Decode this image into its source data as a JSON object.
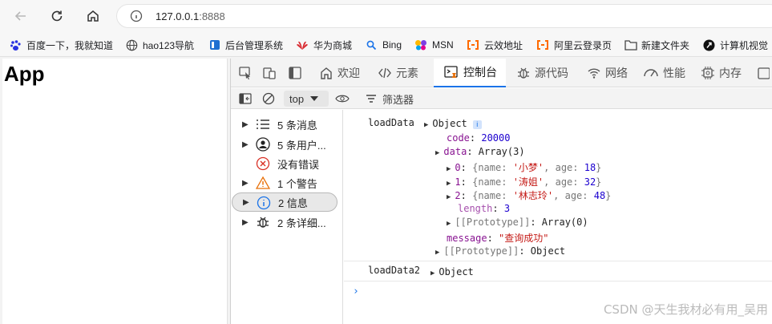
{
  "browser": {
    "url_host": "127.0.0.1",
    "url_port": ":8888"
  },
  "bookmarks": [
    {
      "label": "百度一下，我就知道",
      "color": "#2932e1"
    },
    {
      "label": "hao123导航",
      "color": "#444444"
    },
    {
      "label": "后台管理系统",
      "color": "#1f6fd1"
    },
    {
      "label": "华为商城",
      "color": "#d8282f"
    },
    {
      "label": "Bing",
      "color": "#1a73e8"
    },
    {
      "label": "MSN",
      "color": "#7b3fe4"
    },
    {
      "label": "云效地址",
      "color": "#ff6a00"
    },
    {
      "label": "阿里云登录页",
      "color": "#ff6a00"
    },
    {
      "label": "新建文件夹",
      "color": "#555555"
    },
    {
      "label": "计算机视觉"
    }
  ],
  "page": {
    "heading": "App"
  },
  "devtools": {
    "tabs": [
      {
        "label": "欢迎",
        "icon": "home-icon"
      },
      {
        "label": "元素",
        "icon": "code-icon"
      },
      {
        "label": "控制台",
        "icon": "console-icon",
        "active": true
      },
      {
        "label": "源代码",
        "icon": "bug-icon"
      },
      {
        "label": "网络",
        "icon": "wifi-icon"
      },
      {
        "label": "性能",
        "icon": "gauge-icon"
      },
      {
        "label": "内存",
        "icon": "chip-icon"
      }
    ],
    "context": "top",
    "filter_placeholder": "筛选器",
    "sidebar": [
      {
        "label": "5 条消息",
        "icon": "list-icon",
        "expandable": true
      },
      {
        "label": "5 条用户...",
        "icon": "user-icon",
        "expandable": true
      },
      {
        "label": "没有错误",
        "icon": "error-icon",
        "expandable": false
      },
      {
        "label": "1 个警告",
        "icon": "warning-icon",
        "expandable": true
      },
      {
        "label": "2 信息",
        "icon": "info-icon",
        "expandable": true,
        "selected": true
      },
      {
        "label": "2 条详细...",
        "icon": "bug-icon",
        "expandable": true
      }
    ],
    "console": {
      "log1_label": "loadData",
      "log1_object": "Object",
      "code_key": "code",
      "code_value": "20000",
      "data_key": "data",
      "data_type": "Array(3)",
      "items": [
        {
          "index": "0",
          "name": "'小梦'",
          "age": "18"
        },
        {
          "index": "1",
          "name": "'涛姐'",
          "age": "32"
        },
        {
          "index": "2",
          "name": "'林志玲'",
          "age": "48"
        }
      ],
      "length_key": "length",
      "length_value": "3",
      "proto_array_key": "[[Prototype]]",
      "proto_array_value": "Array(0)",
      "message_key": "message",
      "message_value": "\"查询成功\"",
      "proto_object_key": "[[Prototype]]",
      "proto_object_value": "Object",
      "log2_label": "loadData2",
      "log2_object": "Object",
      "prompt": "›"
    }
  },
  "watermark": "CSDN @天生我材必有用_吴用"
}
